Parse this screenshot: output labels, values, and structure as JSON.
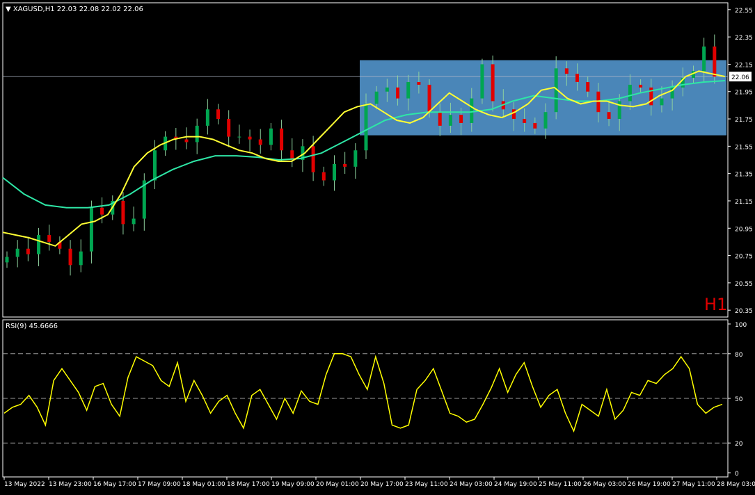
{
  "header": {
    "symbol_line": "XAGUSD,H1  22.03 22.08 22.02 22.06"
  },
  "timeframe_label": "H1",
  "rsi_header": "RSI(9) 45.6666",
  "current_price_label": "22.06",
  "colors": {
    "background": "#000000",
    "bull_candle": "#00a651",
    "bear_candle": "#e00000",
    "wick": "#8fd19e",
    "ma_fast": "#ffff33",
    "ma_slow": "#2ee6a6",
    "range_box": "#4a86b8",
    "rsi_line": "#ffff00",
    "grid_dash": "#9a9a9a",
    "timeframe_label": "#e00000",
    "border": "#ffffff"
  },
  "chart_data": [
    {
      "type": "candlestick",
      "symbol": "XAGUSD",
      "title": "XAGUSD,H1",
      "ohlc_last": {
        "open": 22.03,
        "high": 22.08,
        "low": 22.02,
        "close": 22.06
      },
      "y_ticks": [
        "22.55",
        "22.35",
        "22.15",
        "21.95",
        "21.75",
        "21.55",
        "21.35",
        "21.15",
        "20.95",
        "20.75",
        "20.55",
        "20.35"
      ],
      "ylim": [
        20.3,
        22.6
      ],
      "x_ticks": [
        "13 May 2022",
        "13 May 23:00",
        "16 May 17:00",
        "17 May 09:00",
        "18 May 01:00",
        "18 May 17:00",
        "19 May 09:00",
        "20 May 01:00",
        "20 May 17:00",
        "23 May 11:00",
        "24 May 03:00",
        "24 May 19:00",
        "25 May 11:00",
        "26 May 03:00",
        "26 May 19:00",
        "27 May 11:00",
        "28 May 03:00"
      ],
      "close_series": [
        20.74,
        20.8,
        20.76,
        20.9,
        20.85,
        20.8,
        20.68,
        20.78,
        21.1,
        21.05,
        21.15,
        20.98,
        21.02,
        21.3,
        21.52,
        21.62,
        21.6,
        21.58,
        21.7,
        21.82,
        21.75,
        21.62,
        21.62,
        21.6,
        21.56,
        21.68,
        21.52,
        21.45,
        21.55,
        21.36,
        21.3,
        21.42,
        21.4,
        21.52,
        21.86,
        21.95,
        21.98,
        21.9,
        22.02,
        22.0,
        21.8,
        21.7,
        21.78,
        21.72,
        21.9,
        22.15,
        21.88,
        21.82,
        21.75,
        21.72,
        21.68,
        21.8,
        22.12,
        22.08,
        22.02,
        21.95,
        21.8,
        21.75,
        21.88,
        22.0,
        21.98,
        21.85,
        21.9,
        21.98,
        22.05,
        22.1,
        22.28,
        22.06
      ],
      "ma_fast_series": [
        20.92,
        20.9,
        20.88,
        20.85,
        20.82,
        20.9,
        20.98,
        21.0,
        21.05,
        21.2,
        21.4,
        21.5,
        21.56,
        21.6,
        21.62,
        21.62,
        21.6,
        21.56,
        21.52,
        21.5,
        21.46,
        21.44,
        21.44,
        21.5,
        21.6,
        21.7,
        21.8,
        21.84,
        21.86,
        21.8,
        21.74,
        21.72,
        21.76,
        21.85,
        21.94,
        21.88,
        21.82,
        21.78,
        21.76,
        21.8,
        21.86,
        21.96,
        21.98,
        21.9,
        21.86,
        21.88,
        21.88,
        21.85,
        21.84,
        21.86,
        21.92,
        21.96,
        22.06,
        22.1,
        22.08,
        22.06
      ],
      "ma_slow_series": [
        21.32,
        21.2,
        21.12,
        21.1,
        21.1,
        21.12,
        21.2,
        21.3,
        21.38,
        21.44,
        21.48,
        21.48,
        21.47,
        21.45,
        21.46,
        21.5,
        21.58,
        21.66,
        21.74,
        21.78,
        21.8,
        21.8,
        21.8,
        21.82,
        21.88,
        21.92,
        21.9,
        21.88,
        21.88,
        21.9,
        21.94,
        21.97,
        22.0,
        22.02,
        22.03
      ],
      "range_box": {
        "top": 22.18,
        "bottom": 21.63,
        "from": "20 May 17:00",
        "to": "28 May 03:00"
      },
      "current_price": 22.06
    },
    {
      "type": "line",
      "title": "RSI(9) 45.6666",
      "indicator": "RSI",
      "period": 9,
      "last_value": 45.6666,
      "levels": [
        20,
        50,
        80
      ],
      "y_ticks": [
        "100",
        "80",
        "50",
        "20",
        "0"
      ],
      "ylim": [
        0,
        100
      ],
      "values": [
        40,
        44,
        46,
        52,
        44,
        32,
        62,
        70,
        62,
        54,
        42,
        58,
        60,
        46,
        38,
        64,
        78,
        75,
        72,
        62,
        58,
        74,
        48,
        62,
        52,
        40,
        48,
        52,
        40,
        30,
        52,
        56,
        46,
        36,
        50,
        40,
        55,
        48,
        46,
        66,
        80,
        80,
        78,
        66,
        56,
        78,
        60,
        32,
        30,
        32,
        56,
        62,
        70,
        55,
        40,
        38,
        34,
        36,
        46,
        57,
        70,
        54,
        66,
        74,
        58,
        44,
        52,
        56,
        40,
        28,
        46,
        42,
        38,
        56,
        36,
        42,
        54,
        52,
        62,
        60,
        66,
        70,
        78,
        70,
        46,
        40,
        44,
        46
      ]
    }
  ]
}
